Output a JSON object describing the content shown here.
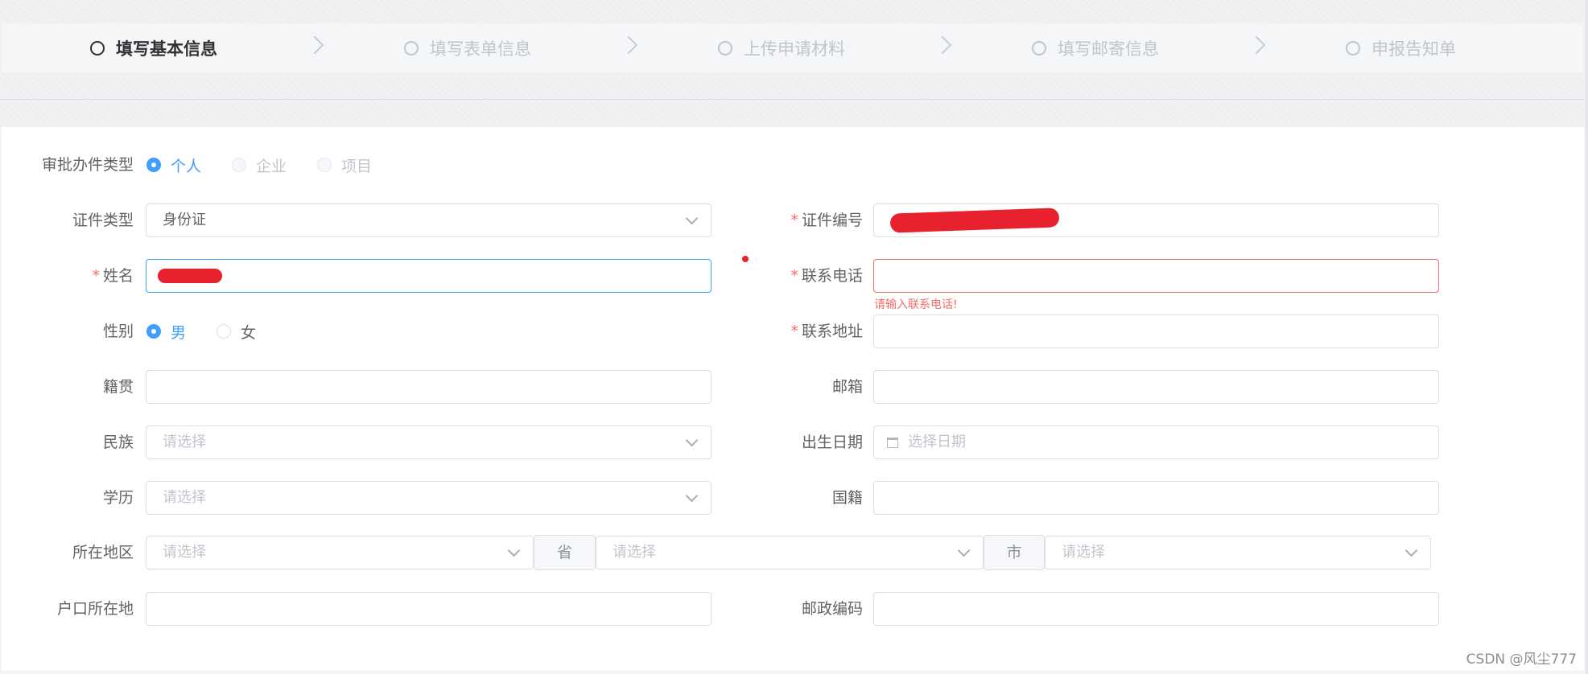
{
  "steps": [
    {
      "label": "填写基本信息",
      "active": true
    },
    {
      "label": "填写表单信息",
      "active": false
    },
    {
      "label": "上传申请材料",
      "active": false
    },
    {
      "label": "填写邮寄信息",
      "active": false
    },
    {
      "label": "申报告知单",
      "active": false
    }
  ],
  "form": {
    "approval_type": {
      "label": "审批办件类型",
      "options": [
        "个人",
        "企业",
        "项目"
      ],
      "selected": "个人"
    },
    "id_type": {
      "label": "证件类型",
      "value": "身份证"
    },
    "id_number": {
      "label": "证件编号",
      "value": ""
    },
    "name": {
      "label": "姓名",
      "value": ""
    },
    "phone": {
      "label": "联系电话",
      "value": "",
      "error": "请输入联系电话!"
    },
    "gender": {
      "label": "性别",
      "options": [
        "男",
        "女"
      ],
      "selected": "男"
    },
    "address": {
      "label": "联系地址",
      "value": ""
    },
    "native_place": {
      "label": "籍贯",
      "value": ""
    },
    "email": {
      "label": "邮箱",
      "value": ""
    },
    "ethnicity": {
      "label": "民族",
      "placeholder": "请选择"
    },
    "birth_date": {
      "label": "出生日期",
      "placeholder": "选择日期"
    },
    "education": {
      "label": "学历",
      "placeholder": "请选择"
    },
    "nationality": {
      "label": "国籍",
      "value": ""
    },
    "region": {
      "label": "所在地区",
      "placeholder_1": "请选择",
      "province_tag": "省",
      "placeholder_2": "请选择",
      "city_tag": "市",
      "placeholder_3": "请选择"
    },
    "household": {
      "label": "户口所在地",
      "value": ""
    },
    "postcode": {
      "label": "邮政编码",
      "value": ""
    }
  },
  "watermark": "CSDN @风尘777",
  "colors": {
    "primary": "#409eff",
    "error": "#f56c6c",
    "redaction": "#e8212e"
  }
}
